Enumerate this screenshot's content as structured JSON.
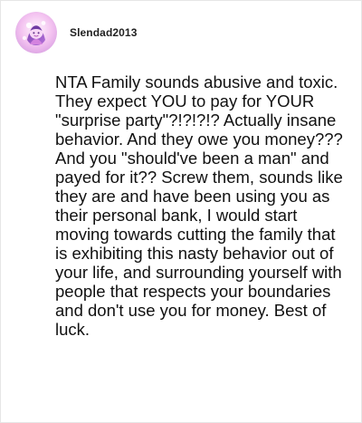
{
  "post": {
    "username": "Slendad2013",
    "avatar_icon": "avatar-icon",
    "comment_text": "NTA Family sounds abusive and toxic. They expect YOU to pay for YOUR \"surprise party\"?!?!?!? Actually insane behavior. And they owe you money??? And you \"should've been a man\" and payed for it?? Screw them, sounds like they are and have been using you as their personal bank, I would start moving towards cutting the family that is exhibiting this nasty behavior out of your life, and surrounding yourself with people that respects your boundaries and don't use you for money. Best of luck."
  },
  "colors": {
    "avatar_pink": "#e7a9e8",
    "avatar_purple": "#7a43a8",
    "text": "#111111",
    "username": "#222222",
    "border": "#e6e6e6"
  }
}
